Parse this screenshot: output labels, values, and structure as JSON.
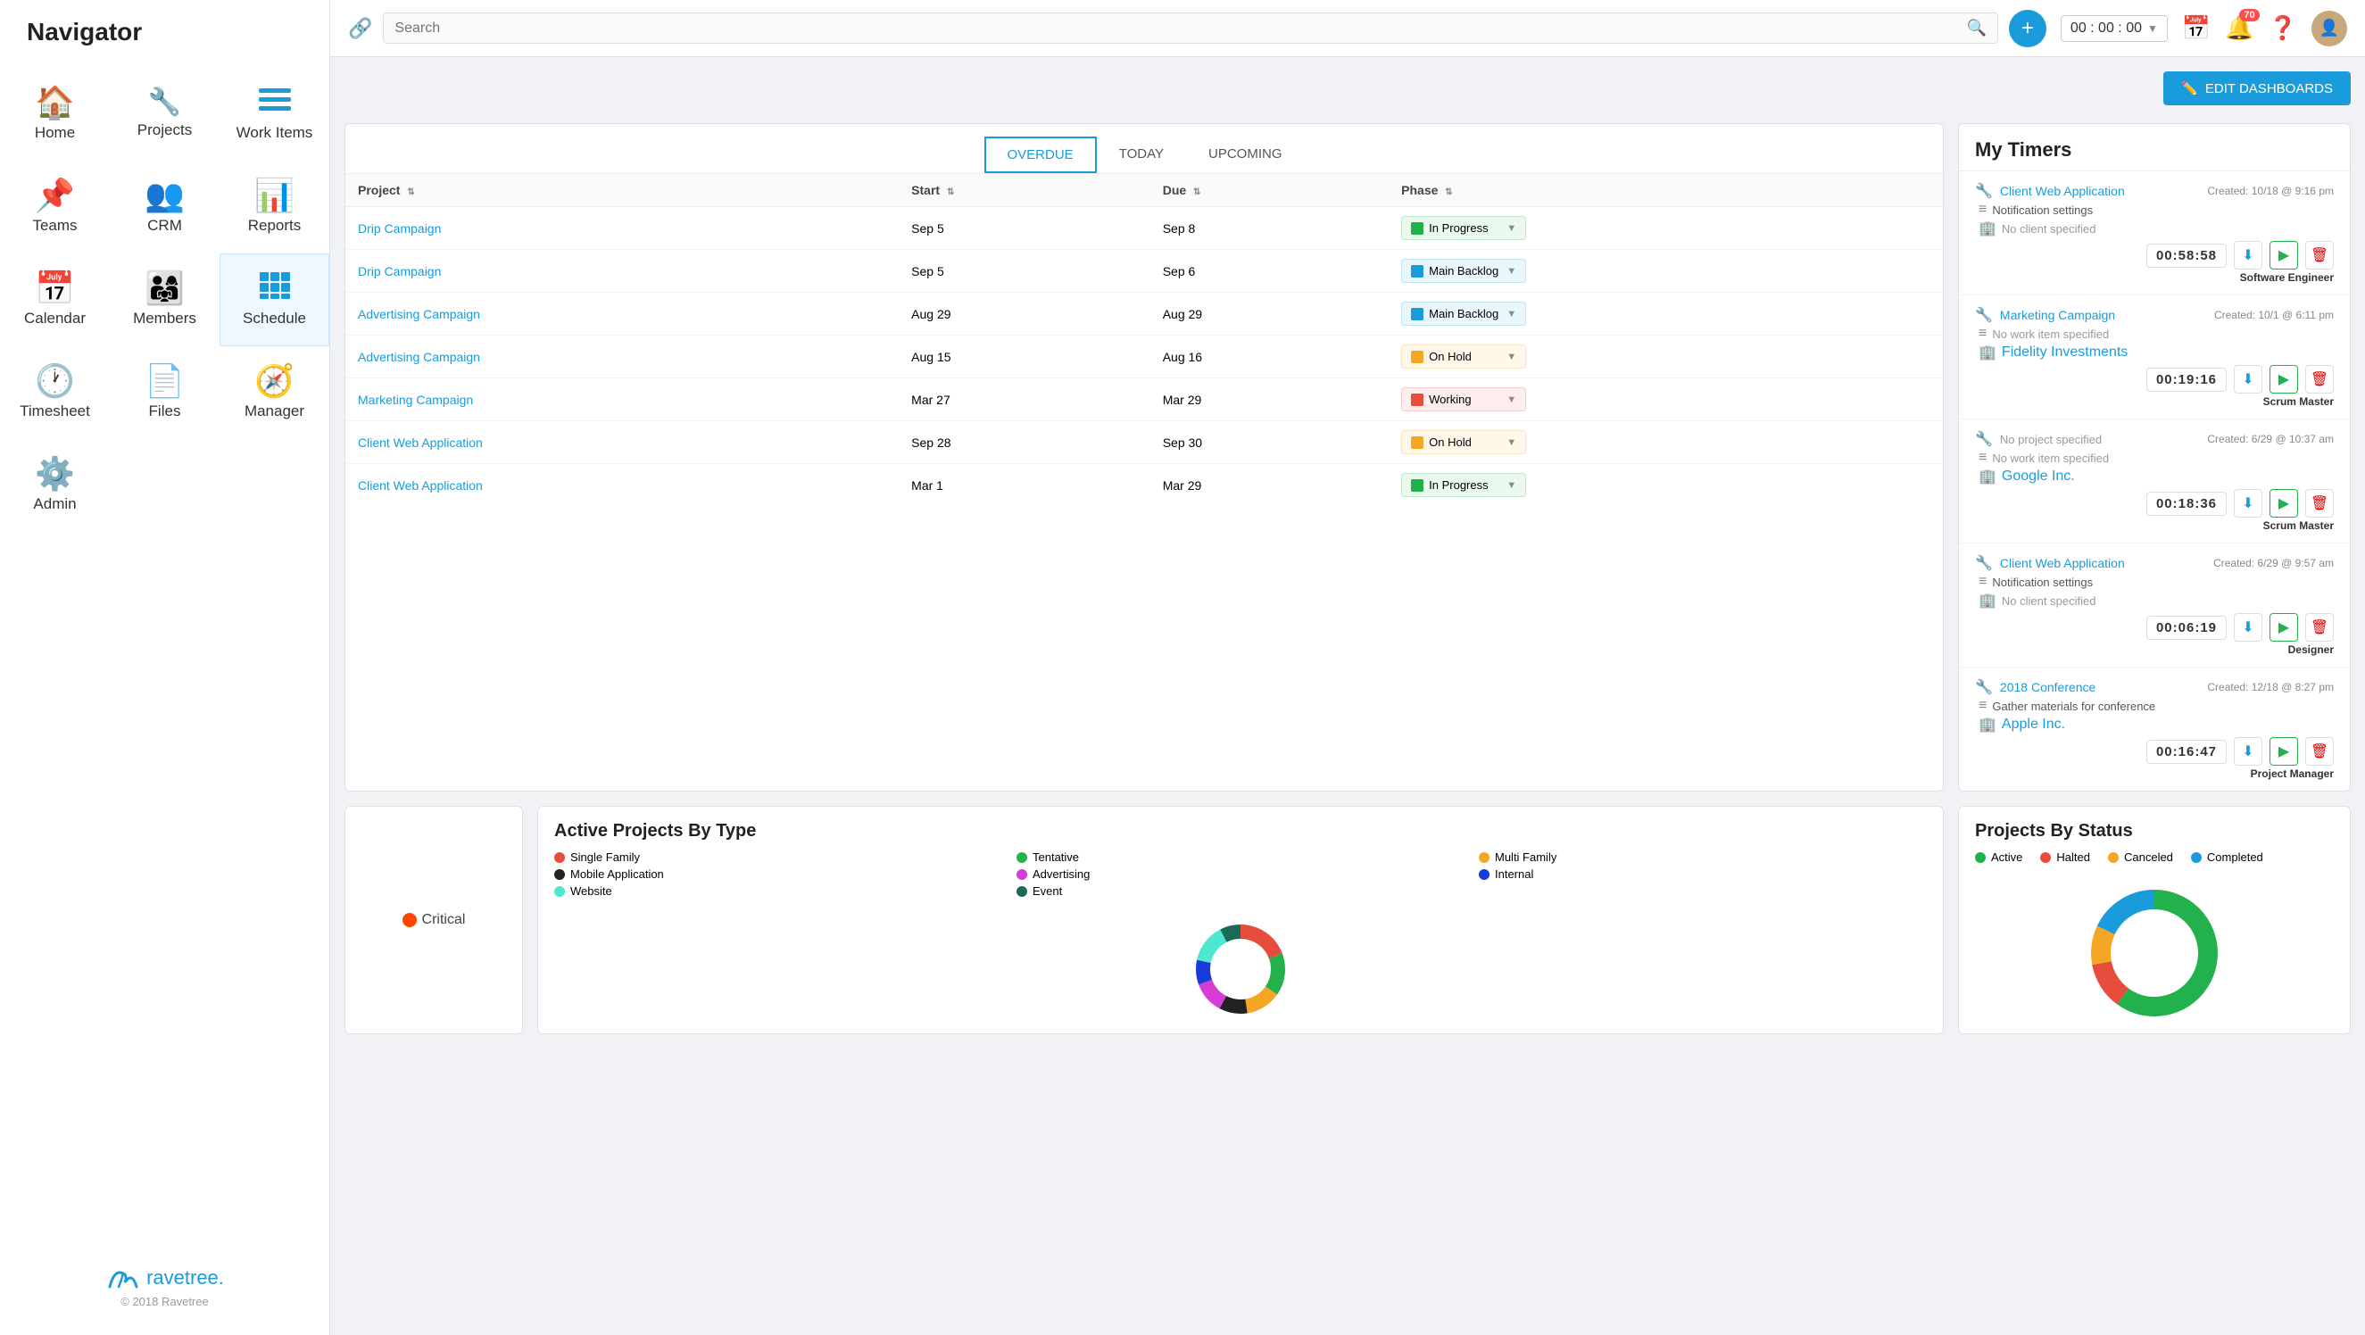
{
  "sidebar": {
    "title": "Navigator",
    "items": [
      {
        "id": "home",
        "label": "Home",
        "icon": "🏠"
      },
      {
        "id": "projects",
        "label": "Projects",
        "icon": "🔧"
      },
      {
        "id": "work-items",
        "label": "Work Items",
        "icon": "☰"
      },
      {
        "id": "teams",
        "label": "Teams",
        "icon": "📌"
      },
      {
        "id": "crm",
        "label": "CRM",
        "icon": "👥"
      },
      {
        "id": "reports",
        "label": "Reports",
        "icon": "📊"
      },
      {
        "id": "calendar",
        "label": "Calendar",
        "icon": "📅"
      },
      {
        "id": "members",
        "label": "Members",
        "icon": "👨‍👩‍👧"
      },
      {
        "id": "schedule",
        "label": "Schedule",
        "icon": "▦"
      },
      {
        "id": "timesheet",
        "label": "Timesheet",
        "icon": "🕐"
      },
      {
        "id": "files",
        "label": "Files",
        "icon": "📄"
      },
      {
        "id": "manager",
        "label": "Manager",
        "icon": "🧭"
      },
      {
        "id": "admin",
        "label": "Admin",
        "icon": "⚙️"
      }
    ],
    "logo_text": "ravetree.",
    "copyright": "© 2018 Ravetree"
  },
  "topbar": {
    "search_placeholder": "Search",
    "timer_value": "00 : 00 : 00",
    "notification_count": "70",
    "edit_dashboards_label": "EDIT DASHBOARDS"
  },
  "work_items": {
    "tab_overdue": "OVERDUE",
    "tab_today": "TODAY",
    "tab_upcoming": "UPCOMING",
    "active_tab": "OVERDUE",
    "columns": [
      "Project",
      "Start",
      "Due",
      "Phase"
    ],
    "rows": [
      {
        "project": "Drip Campaign",
        "start": "Sep 5",
        "due": "Sep 8",
        "phase": "In Progress",
        "phase_color": "#22b14c"
      },
      {
        "project": "Drip Campaign",
        "start": "Sep 5",
        "due": "Sep 6",
        "phase": "Main Backlog",
        "phase_color": "#1a9bdb"
      },
      {
        "project": "Advertising Campaign",
        "start": "Aug 29",
        "due": "Aug 29",
        "phase": "Main Backlog",
        "phase_color": "#1a9bdb"
      },
      {
        "project": "Advertising Campaign",
        "start": "Aug 15",
        "due": "Aug 16",
        "phase": "On Hold",
        "phase_color": "#f5a623"
      },
      {
        "project": "Marketing Campaign",
        "start": "Mar 27",
        "due": "Mar 29",
        "phase": "Working",
        "phase_color": "#e84c3d"
      },
      {
        "project": "Client Web Application",
        "start": "Sep 28",
        "due": "Sep 30",
        "phase": "On Hold",
        "phase_color": "#f5a623"
      },
      {
        "project": "Client Web Application",
        "start": "Mar 1",
        "due": "Mar 29",
        "phase": "In Progress",
        "phase_color": "#22b14c"
      }
    ]
  },
  "my_timers": {
    "title": "My Timers",
    "timers": [
      {
        "project": "Client Web Application",
        "work_item": "Notification settings",
        "client": "No client specified",
        "client_is_link": false,
        "created": "Created: 10/18 @ 9:16 pm",
        "time": "00:58:58",
        "role": "Software Engineer"
      },
      {
        "project": "Marketing Campaign",
        "work_item": "No work item specified",
        "client": "Fidelity Investments",
        "client_is_link": true,
        "created": "Created: 10/1 @ 6:11 pm",
        "time": "00:19:16",
        "role": "Scrum Master"
      },
      {
        "project": "No project specified",
        "work_item": "No work item specified",
        "client": "Google Inc.",
        "client_is_link": true,
        "created": "Created: 6/29 @ 10:37 am",
        "time": "00:18:36",
        "role": "Scrum Master"
      },
      {
        "project": "Client Web Application",
        "work_item": "Notification settings",
        "client": "No client specified",
        "client_is_link": false,
        "created": "Created: 6/29 @ 9:57 am",
        "time": "00:06:19",
        "role": "Designer"
      },
      {
        "project": "2018 Conference",
        "work_item": "Gather materials for conference",
        "client": "Apple Inc.",
        "client_is_link": true,
        "created": "Created: 12/18 @ 8:27 pm",
        "time": "00:16:47",
        "role": "Project Manager"
      }
    ]
  },
  "active_projects": {
    "title": "Active Projects By Type",
    "legend": [
      {
        "label": "Single Family",
        "color": "#e84c3d"
      },
      {
        "label": "Tentative",
        "color": "#22b14c"
      },
      {
        "label": "Multi Family",
        "color": "#f5a623"
      },
      {
        "label": "Mobile Application",
        "color": "#222222"
      },
      {
        "label": "Advertising",
        "color": "#d63cd6"
      },
      {
        "label": "Internal",
        "color": "#1a3bdb"
      },
      {
        "label": "Website",
        "color": "#4de8d0"
      },
      {
        "label": "Event",
        "color": "#1a6b55"
      }
    ],
    "donut_segments": [
      {
        "value": 15,
        "color": "#e84c3d"
      },
      {
        "value": 12,
        "color": "#22b14c"
      },
      {
        "value": 10,
        "color": "#f5a623"
      },
      {
        "value": 8,
        "color": "#222222"
      },
      {
        "value": 9,
        "color": "#d63cd6"
      },
      {
        "value": 7,
        "color": "#1a3bdb"
      },
      {
        "value": 11,
        "color": "#4de8d0"
      },
      {
        "value": 6,
        "color": "#1a6b55"
      }
    ]
  },
  "critical_label": "Critical",
  "projects_by_status": {
    "title": "Projects By Status",
    "legend": [
      {
        "label": "Active",
        "color": "#22b14c"
      },
      {
        "label": "Halted",
        "color": "#e84c3d"
      },
      {
        "label": "Canceled",
        "color": "#f5a623"
      },
      {
        "label": "Completed",
        "color": "#1a9bdb"
      }
    ],
    "donut_segments": [
      {
        "value": 60,
        "color": "#22b14c"
      },
      {
        "value": 12,
        "color": "#e84c3d"
      },
      {
        "value": 10,
        "color": "#f5a623"
      },
      {
        "value": 18,
        "color": "#1a9bdb"
      }
    ]
  }
}
